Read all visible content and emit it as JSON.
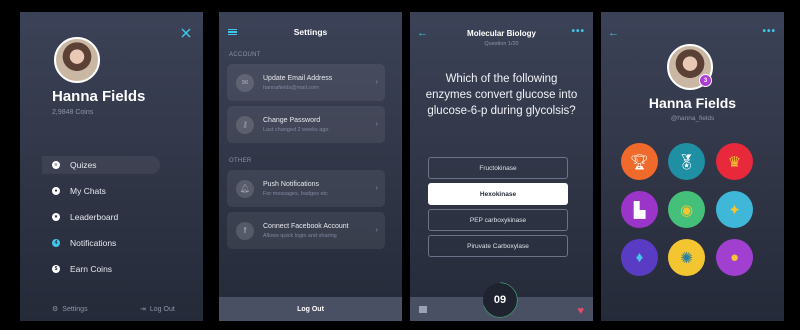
{
  "menu_screen": {
    "user_name": "Hanna Fields",
    "coins": "2,9848 Coins",
    "items": [
      {
        "label": "Quizes",
        "icon": "quiz-icon",
        "badge": ""
      },
      {
        "label": "My Chats",
        "icon": "chat-icon",
        "badge": ""
      },
      {
        "label": "Leaderboard",
        "icon": "star-icon",
        "badge": ""
      },
      {
        "label": "Notifications",
        "icon": "notification-icon",
        "badge": "4"
      },
      {
        "label": "Earn Coins",
        "icon": "coin-icon",
        "badge": ""
      }
    ],
    "settings_label": "Settings",
    "logout_label": "Log Out"
  },
  "settings_screen": {
    "title": "Settings",
    "account_label": "ACCOUNT",
    "other_label": "OTHER",
    "cards": [
      {
        "title": "Update Email Address",
        "sub": "hannafields@mail.com",
        "icon": "mail-icon"
      },
      {
        "title": "Change Password",
        "sub": "Last changed 2 weeks ago",
        "icon": "key-icon"
      },
      {
        "title": "Push Notifications",
        "sub": "For messages, badges etc",
        "icon": "bell-icon"
      },
      {
        "title": "Connect Facebook Account",
        "sub": "Allows quick login and sharing",
        "icon": "facebook-icon"
      }
    ],
    "logout_label": "Log Out"
  },
  "quiz_screen": {
    "title": "Molecular Biology",
    "subtitle": "Question 1/20",
    "question": "Which of the following enzymes convert glucose into glucose-6-p during glycolsis?",
    "answers": [
      "Fructokinase",
      "Hexokinase",
      "PEP carboxykinase",
      "Piruvate Carboxylase"
    ],
    "selected_answer": "Hexokinase",
    "timer": "09"
  },
  "profile_screen": {
    "user_name": "Hanna Fields",
    "handle": "@hanna_fields",
    "level": "3",
    "badges": [
      {
        "icon": "trophy-icon",
        "color": "#f06b2b"
      },
      {
        "icon": "medal-icon",
        "color": "#1f8fa3"
      },
      {
        "icon": "crown-icon",
        "color": "#e8293c"
      },
      {
        "icon": "podium-icon",
        "color": "#9b34c9"
      },
      {
        "icon": "ribbon-medal-icon",
        "color": "#45c07a"
      },
      {
        "icon": "stars-icon",
        "color": "#3fb7d9"
      },
      {
        "icon": "wings-shield-icon",
        "color": "#5a3cc4"
      },
      {
        "icon": "rosette-icon",
        "color": "#f2c531"
      },
      {
        "icon": "gold-medal-icon",
        "color": "#a13fd1"
      }
    ]
  }
}
